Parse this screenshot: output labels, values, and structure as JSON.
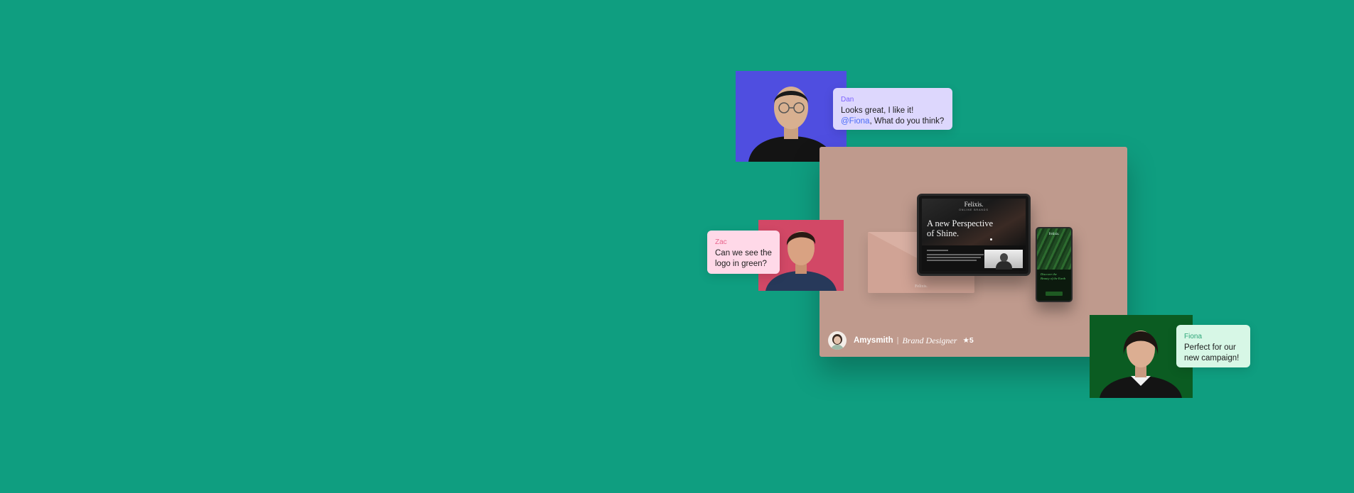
{
  "comments": [
    {
      "author": "Dan",
      "lines": [
        "Looks great, I like it!"
      ],
      "mention": "@Fiona",
      "mention_rest": ", What do you think?",
      "bg": "#ddd7fd",
      "name_color": "#7b61ff"
    },
    {
      "author": "Zac",
      "lines": [
        "Can we see the",
        "logo in green?"
      ],
      "bg": "#ffd9e8",
      "name_color": "#e8678e"
    },
    {
      "author": "Fiona",
      "lines": [
        "Perfect for our",
        "new campaign!"
      ],
      "bg": "#d7f7e6",
      "name_color": "#2fa77a"
    }
  ],
  "showcase": {
    "tablet_brand": "Felixis.",
    "tablet_tagline": "ONLINE BRANDS",
    "tablet_headline_1": "A new Perspective",
    "tablet_headline_2": "of Shine.",
    "phone_brand": "Felixis.",
    "phone_text_1": "Discover the",
    "phone_text_2": "Beauty of the Earth",
    "envelope_logo": "Felixis."
  },
  "designer": {
    "name": "Amysmith",
    "separator": "|",
    "role": "Brand Designer",
    "rating": "★5"
  },
  "colors": {
    "background": "#0f9e80",
    "card": "#bf9a8d",
    "dan_photo_bg": "#4f4ee0",
    "zac_photo_bg": "#d24866",
    "fiona_photo_bg": "#0b5c22"
  }
}
